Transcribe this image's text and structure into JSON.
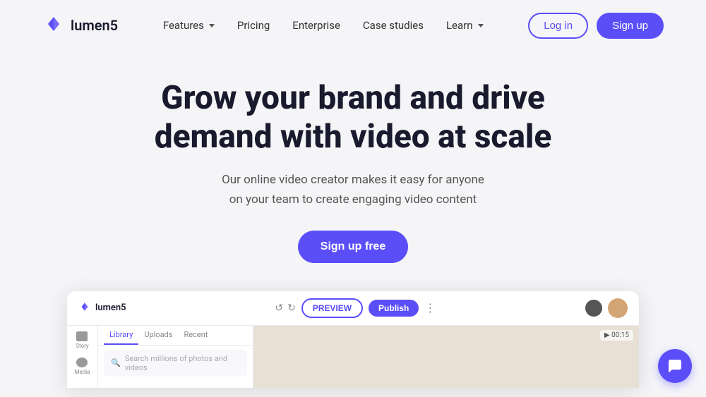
{
  "brand": {
    "name": "lumen5",
    "logo_color": "#5b4ef8"
  },
  "nav": {
    "links": [
      {
        "label": "Features",
        "has_dropdown": true
      },
      {
        "label": "Pricing",
        "has_dropdown": false
      },
      {
        "label": "Enterprise",
        "has_dropdown": false
      },
      {
        "label": "Case studies",
        "has_dropdown": false
      },
      {
        "label": "Learn",
        "has_dropdown": true
      }
    ],
    "login_label": "Log in",
    "signup_label": "Sign up"
  },
  "hero": {
    "title_line1": "Grow your brand and drive",
    "title_line2": "demand with video at scale",
    "subtitle_line1": "Our online video creator makes it easy for anyone",
    "subtitle_line2": "on your team to create engaging video content",
    "cta_label": "Sign up free"
  },
  "app_preview": {
    "logo_text": "lumen5",
    "btn_preview": "PREVIEW",
    "btn_publish": "Publish",
    "panel_tabs": [
      "Library",
      "Uploads",
      "Recent"
    ],
    "search_placeholder": "Search millions of photos and videos",
    "timer": "00:15",
    "sidebar_items": [
      {
        "label": "Story"
      },
      {
        "label": "Media"
      }
    ]
  },
  "chat": {
    "icon": "chat-icon"
  },
  "colors": {
    "brand_purple": "#5b4ef8",
    "bg_light": "#f5f5f8",
    "text_dark": "#1a1a2e",
    "text_muted": "#555"
  }
}
